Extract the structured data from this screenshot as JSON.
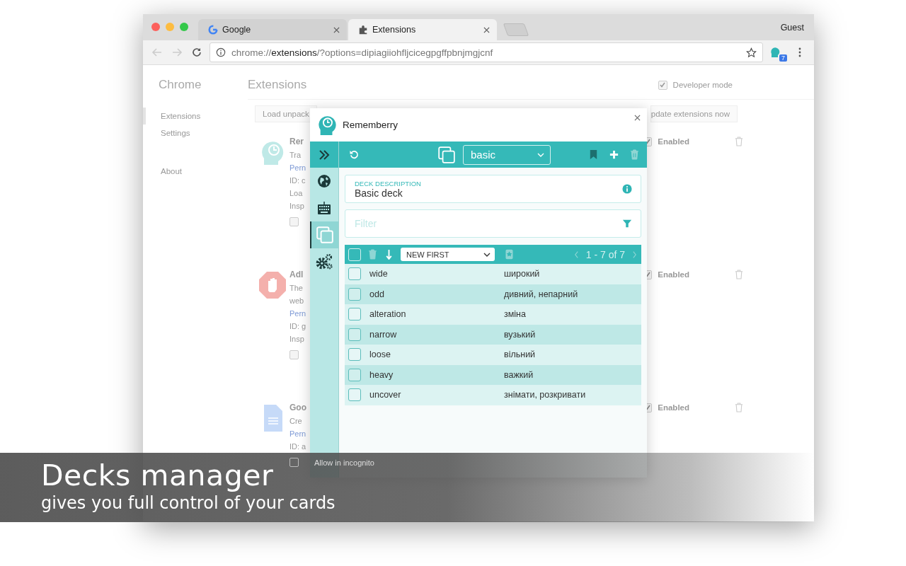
{
  "browser": {
    "tabs": [
      {
        "label": "Google",
        "kind": "google",
        "selected": false
      },
      {
        "label": "Extensions",
        "kind": "puzzle",
        "selected": true
      }
    ],
    "profile": "Guest",
    "address": {
      "scheme": "chrome://",
      "host": "extensions",
      "rest": "/?options=dipiagiiohfljcicegpgffpbnjmgjcnf"
    },
    "extension_badge": "7"
  },
  "page": {
    "brand": "Chrome",
    "heading": "Extensions",
    "nav": [
      {
        "label": "Extensions",
        "selected": true
      },
      {
        "label": "Settings",
        "selected": false
      },
      {
        "label": "About",
        "selected": false
      }
    ],
    "developer_mode": {
      "label": "Developer mode",
      "checked": true
    },
    "buttons": [
      "Load unpack",
      "pdate extensions now"
    ],
    "extensions": [
      {
        "name": "Rer",
        "lines": [
          {
            "text": "Tra",
            "kind": "text"
          },
          {
            "text": "Pern",
            "kind": "link"
          },
          {
            "text": "ID: c",
            "kind": "text"
          },
          {
            "text": "Loa",
            "kind": "text"
          },
          {
            "text": "Insp",
            "kind": "text"
          }
        ],
        "option": {
          "checked": false
        },
        "enabled": {
          "label": "Enabled",
          "checked": true
        }
      },
      {
        "name": "Adl",
        "lines": [
          {
            "text": "The",
            "kind": "text"
          },
          {
            "text": "web",
            "kind": "text"
          },
          {
            "text": "Pern",
            "kind": "link"
          },
          {
            "text": "ID: g",
            "kind": "text"
          },
          {
            "text": "Insp",
            "kind": "text"
          }
        ],
        "option": {
          "checked": false
        },
        "enabled": {
          "label": "Enabled",
          "checked": true
        }
      },
      {
        "name": "Goo",
        "lines": [
          {
            "text": "Cre",
            "kind": "text"
          },
          {
            "text": "Pern",
            "kind": "link"
          },
          {
            "text": "ID: a",
            "kind": "text"
          }
        ],
        "option": {
          "checked": false,
          "label": "Allow in incognito"
        },
        "enabled": {
          "label": "Enabled",
          "checked": true
        }
      }
    ]
  },
  "popup": {
    "title": "Rememberry",
    "nav": [
      {
        "kind": "expand",
        "selected": false
      },
      {
        "kind": "globe",
        "selected": false
      },
      {
        "kind": "keyboard",
        "selected": false
      },
      {
        "kind": "decks",
        "selected": true
      },
      {
        "kind": "settings",
        "selected": false
      }
    ],
    "deck": "basic",
    "description": {
      "label": "DECK DESCRIPTION",
      "value": "Basic deck"
    },
    "filter": {
      "placeholder": "Filter"
    },
    "sort": "NEW FIRST",
    "pagination": "1 - 7 of 7",
    "select_all": {
      "checked": false
    },
    "cards": [
      {
        "word": "wide",
        "translation": "широкий",
        "checked": false
      },
      {
        "word": "odd",
        "translation": "дивний, непарний",
        "checked": false
      },
      {
        "word": "alteration",
        "translation": "зміна",
        "checked": false
      },
      {
        "word": "narrow",
        "translation": "вузький",
        "checked": false
      },
      {
        "word": "loose",
        "translation": "вільний",
        "checked": false
      },
      {
        "word": "heavy",
        "translation": "важкий",
        "checked": false
      },
      {
        "word": "uncover",
        "translation": "знімати, розкривати",
        "checked": false
      }
    ]
  },
  "caption": {
    "title": "Decks manager",
    "subtitle": "gives you full control of your cards"
  }
}
